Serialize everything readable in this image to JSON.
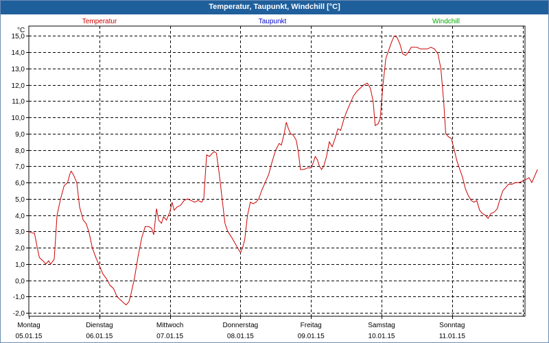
{
  "window": {
    "title": "Temperatur, Taupunkt, Windchill [°C]"
  },
  "colors": {
    "temperature": "#cc0000",
    "dewpoint": "#0000cc",
    "windchill": "#00aa00",
    "grid": "#000000"
  },
  "chart_data": {
    "type": "line",
    "title": "Temperatur, Taupunkt, Windchill [°C]",
    "y_unit": "°C",
    "ylim": [
      -2.2,
      15.6
    ],
    "y_ticks": [
      -2.0,
      -1.0,
      0.0,
      1.0,
      2.0,
      3.0,
      4.0,
      5.0,
      6.0,
      7.0,
      8.0,
      9.0,
      10.0,
      11.0,
      12.0,
      13.0,
      14.0,
      15.0
    ],
    "y_tick_labels": [
      "-2,0",
      "-1,0",
      "0,0",
      "1,0",
      "2,0",
      "3,0",
      "4,0",
      "5,0",
      "6,0",
      "7,0",
      "8,0",
      "9,0",
      "10,0",
      "11,0",
      "12,0",
      "13,0",
      "14,0",
      "15,0"
    ],
    "x_days": [
      {
        "day": "Montag",
        "date": "05.01.15"
      },
      {
        "day": "Dienstag",
        "date": "06.01.15"
      },
      {
        "day": "Mittwoch",
        "date": "07.01.15"
      },
      {
        "day": "Donnerstag",
        "date": "08.01.15"
      },
      {
        "day": "Freitag",
        "date": "09.01.15"
      },
      {
        "day": "Samstag",
        "date": "10.01.15"
      },
      {
        "day": "Sonntag",
        "date": "11.01.15"
      }
    ],
    "grid": true,
    "legend_position": "top",
    "series": [
      {
        "name": "Temperatur",
        "points": [
          [
            0.0,
            3.0
          ],
          [
            0.05,
            2.9
          ],
          [
            0.08,
            2.9
          ],
          [
            0.12,
            2.0
          ],
          [
            0.15,
            1.4
          ],
          [
            0.2,
            1.2
          ],
          [
            0.24,
            1.0
          ],
          [
            0.28,
            1.2
          ],
          [
            0.31,
            1.0
          ],
          [
            0.36,
            1.3
          ],
          [
            0.4,
            4.0
          ],
          [
            0.45,
            5.0
          ],
          [
            0.5,
            5.8
          ],
          [
            0.55,
            6.0
          ],
          [
            0.58,
            6.5
          ],
          [
            0.6,
            6.7
          ],
          [
            0.63,
            6.5
          ],
          [
            0.68,
            6.0
          ],
          [
            0.72,
            4.5
          ],
          [
            0.77,
            3.7
          ],
          [
            0.81,
            3.5
          ],
          [
            0.85,
            3.0
          ],
          [
            0.9,
            2.0
          ],
          [
            0.95,
            1.4
          ],
          [
            1.0,
            0.9
          ],
          [
            1.05,
            0.4
          ],
          [
            1.1,
            0.1
          ],
          [
            1.15,
            -0.3
          ],
          [
            1.2,
            -0.5
          ],
          [
            1.25,
            -1.0
          ],
          [
            1.3,
            -1.2
          ],
          [
            1.35,
            -1.4
          ],
          [
            1.38,
            -1.5
          ],
          [
            1.42,
            -1.3
          ],
          [
            1.45,
            -0.8
          ],
          [
            1.5,
            0.2
          ],
          [
            1.55,
            1.5
          ],
          [
            1.6,
            2.6
          ],
          [
            1.65,
            3.3
          ],
          [
            1.7,
            3.3
          ],
          [
            1.74,
            3.2
          ],
          [
            1.77,
            2.8
          ],
          [
            1.81,
            4.4
          ],
          [
            1.84,
            3.7
          ],
          [
            1.88,
            3.5
          ],
          [
            1.91,
            3.9
          ],
          [
            1.95,
            3.7
          ],
          [
            2.0,
            4.2
          ],
          [
            2.03,
            4.8
          ],
          [
            2.06,
            4.3
          ],
          [
            2.1,
            4.5
          ],
          [
            2.15,
            4.6
          ],
          [
            2.2,
            4.9
          ],
          [
            2.25,
            5.0
          ],
          [
            2.3,
            4.9
          ],
          [
            2.35,
            4.8
          ],
          [
            2.4,
            4.9
          ],
          [
            2.45,
            4.8
          ],
          [
            2.48,
            5.0
          ],
          [
            2.52,
            7.7
          ],
          [
            2.56,
            7.6
          ],
          [
            2.6,
            7.8
          ],
          [
            2.63,
            7.9
          ],
          [
            2.66,
            7.8
          ],
          [
            2.7,
            6.5
          ],
          [
            2.74,
            5.0
          ],
          [
            2.78,
            3.5
          ],
          [
            2.82,
            3.0
          ],
          [
            2.85,
            2.8
          ],
          [
            2.88,
            2.6
          ],
          [
            2.92,
            2.3
          ],
          [
            2.96,
            2.0
          ],
          [
            3.0,
            1.7
          ],
          [
            3.03,
            2.0
          ],
          [
            3.06,
            2.5
          ],
          [
            3.1,
            4.0
          ],
          [
            3.14,
            4.8
          ],
          [
            3.18,
            4.7
          ],
          [
            3.22,
            4.8
          ],
          [
            3.26,
            5.0
          ],
          [
            3.3,
            5.5
          ],
          [
            3.35,
            6.0
          ],
          [
            3.4,
            6.5
          ],
          [
            3.45,
            7.3
          ],
          [
            3.5,
            8.0
          ],
          [
            3.55,
            8.4
          ],
          [
            3.58,
            8.3
          ],
          [
            3.62,
            9.0
          ],
          [
            3.65,
            9.7
          ],
          [
            3.68,
            9.3
          ],
          [
            3.71,
            9.0
          ],
          [
            3.75,
            8.9
          ],
          [
            3.79,
            8.6
          ],
          [
            3.82,
            7.9
          ],
          [
            3.85,
            6.8
          ],
          [
            3.9,
            6.8
          ],
          [
            3.95,
            6.9
          ],
          [
            4.0,
            6.9
          ],
          [
            4.03,
            7.2
          ],
          [
            4.06,
            7.6
          ],
          [
            4.09,
            7.4
          ],
          [
            4.12,
            7.0
          ],
          [
            4.15,
            6.8
          ],
          [
            4.18,
            7.0
          ],
          [
            4.22,
            7.6
          ],
          [
            4.26,
            8.5
          ],
          [
            4.3,
            8.2
          ],
          [
            4.34,
            8.7
          ],
          [
            4.38,
            9.3
          ],
          [
            4.42,
            9.2
          ],
          [
            4.46,
            9.8
          ],
          [
            4.5,
            10.3
          ],
          [
            4.55,
            10.8
          ],
          [
            4.6,
            11.3
          ],
          [
            4.65,
            11.6
          ],
          [
            4.7,
            11.8
          ],
          [
            4.75,
            12.0
          ],
          [
            4.8,
            12.1
          ],
          [
            4.84,
            11.8
          ],
          [
            4.88,
            11.0
          ],
          [
            4.91,
            9.5
          ],
          [
            4.95,
            9.6
          ],
          [
            4.98,
            9.9
          ],
          [
            5.02,
            12.0
          ],
          [
            5.06,
            13.6
          ],
          [
            5.1,
            14.1
          ],
          [
            5.14,
            14.6
          ],
          [
            5.18,
            15.0
          ],
          [
            5.22,
            14.9
          ],
          [
            5.26,
            14.5
          ],
          [
            5.3,
            13.9
          ],
          [
            5.34,
            13.8
          ],
          [
            5.38,
            14.0
          ],
          [
            5.42,
            14.3
          ],
          [
            5.46,
            14.3
          ],
          [
            5.5,
            14.3
          ],
          [
            5.55,
            14.2
          ],
          [
            5.6,
            14.2
          ],
          [
            5.65,
            14.2
          ],
          [
            5.7,
            14.3
          ],
          [
            5.75,
            14.2
          ],
          [
            5.8,
            13.9
          ],
          [
            5.84,
            13.0
          ],
          [
            5.88,
            11.0
          ],
          [
            5.91,
            9.0
          ],
          [
            5.95,
            8.8
          ],
          [
            5.99,
            8.7
          ],
          [
            6.03,
            8.0
          ],
          [
            6.07,
            7.3
          ],
          [
            6.11,
            6.8
          ],
          [
            6.15,
            6.3
          ],
          [
            6.19,
            5.6
          ],
          [
            6.23,
            5.2
          ],
          [
            6.27,
            4.9
          ],
          [
            6.31,
            4.8
          ],
          [
            6.35,
            4.9
          ],
          [
            6.39,
            4.3
          ],
          [
            6.43,
            4.1
          ],
          [
            6.47,
            4.0
          ],
          [
            6.51,
            3.8
          ],
          [
            6.55,
            4.1
          ],
          [
            6.6,
            4.2
          ],
          [
            6.64,
            4.4
          ],
          [
            6.68,
            5.0
          ],
          [
            6.72,
            5.5
          ],
          [
            6.76,
            5.7
          ],
          [
            6.8,
            5.9
          ],
          [
            6.85,
            5.9
          ],
          [
            6.9,
            6.0
          ],
          [
            6.95,
            6.0
          ],
          [
            7.0,
            6.1
          ],
          [
            7.05,
            6.2
          ],
          [
            7.09,
            6.3
          ],
          [
            7.13,
            6.0
          ],
          [
            7.17,
            6.4
          ],
          [
            7.21,
            6.8
          ]
        ]
      },
      {
        "name": "Taupunkt",
        "points": []
      },
      {
        "name": "Windchill",
        "points": []
      }
    ]
  }
}
